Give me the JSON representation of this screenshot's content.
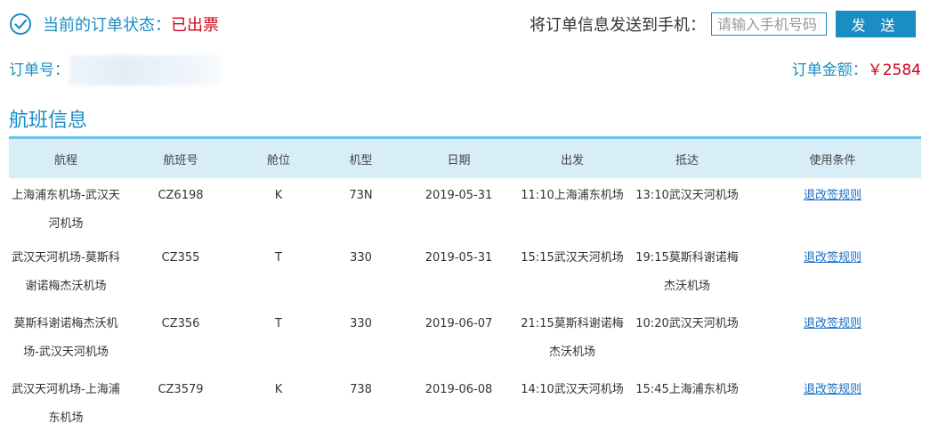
{
  "status": {
    "label": "当前的订单状态：",
    "value": "已出票"
  },
  "send": {
    "label": "将订单信息发送到手机：",
    "phone_placeholder": "请输入手机号码",
    "button_label": "发 送"
  },
  "order": {
    "number_label": "订单号：",
    "amount_label": "订单金额：",
    "amount_value": "￥2584"
  },
  "section": {
    "title": "航班信息"
  },
  "table": {
    "headers": [
      "航程",
      "航班号",
      "舱位",
      "机型",
      "日期",
      "出发",
      "抵达",
      "使用条件"
    ],
    "rows": [
      {
        "route": "上海浦东机场-武汉天河机场",
        "flight": "CZ6198",
        "cabin": "K",
        "aircraft": "73N",
        "date": "2019-05-31",
        "depart": "11:10上海浦东机场",
        "arrive": "13:10武汉天河机场",
        "rule": "退改签规则"
      },
      {
        "route": "武汉天河机场-莫斯科谢诺梅杰沃机场",
        "flight": "CZ355",
        "cabin": "T",
        "aircraft": "330",
        "date": "2019-05-31",
        "depart": "15:15武汉天河机场",
        "arrive": "19:15莫斯科谢诺梅杰沃机场",
        "rule": "退改签规则"
      },
      {
        "route": "莫斯科谢诺梅杰沃机场-武汉天河机场",
        "flight": "CZ356",
        "cabin": "T",
        "aircraft": "330",
        "date": "2019-06-07",
        "depart": "21:15莫斯科谢诺梅杰沃机场",
        "arrive": "10:20武汉天河机场",
        "rule": "退改签规则"
      },
      {
        "route": "武汉天河机场-上海浦东机场",
        "flight": "CZ3579",
        "cabin": "K",
        "aircraft": "738",
        "date": "2019-06-08",
        "depart": "14:10武汉天河机场",
        "arrive": "15:45上海浦东机场",
        "rule": "退改签规则"
      }
    ]
  },
  "colors": {
    "accent": "#1a8dc4",
    "alert": "#d0021b",
    "header_bg": "#d7eef9",
    "rule": "#6cc4e8",
    "link": "#1a6fc4"
  },
  "icons": {
    "status": "check-circle-icon"
  }
}
